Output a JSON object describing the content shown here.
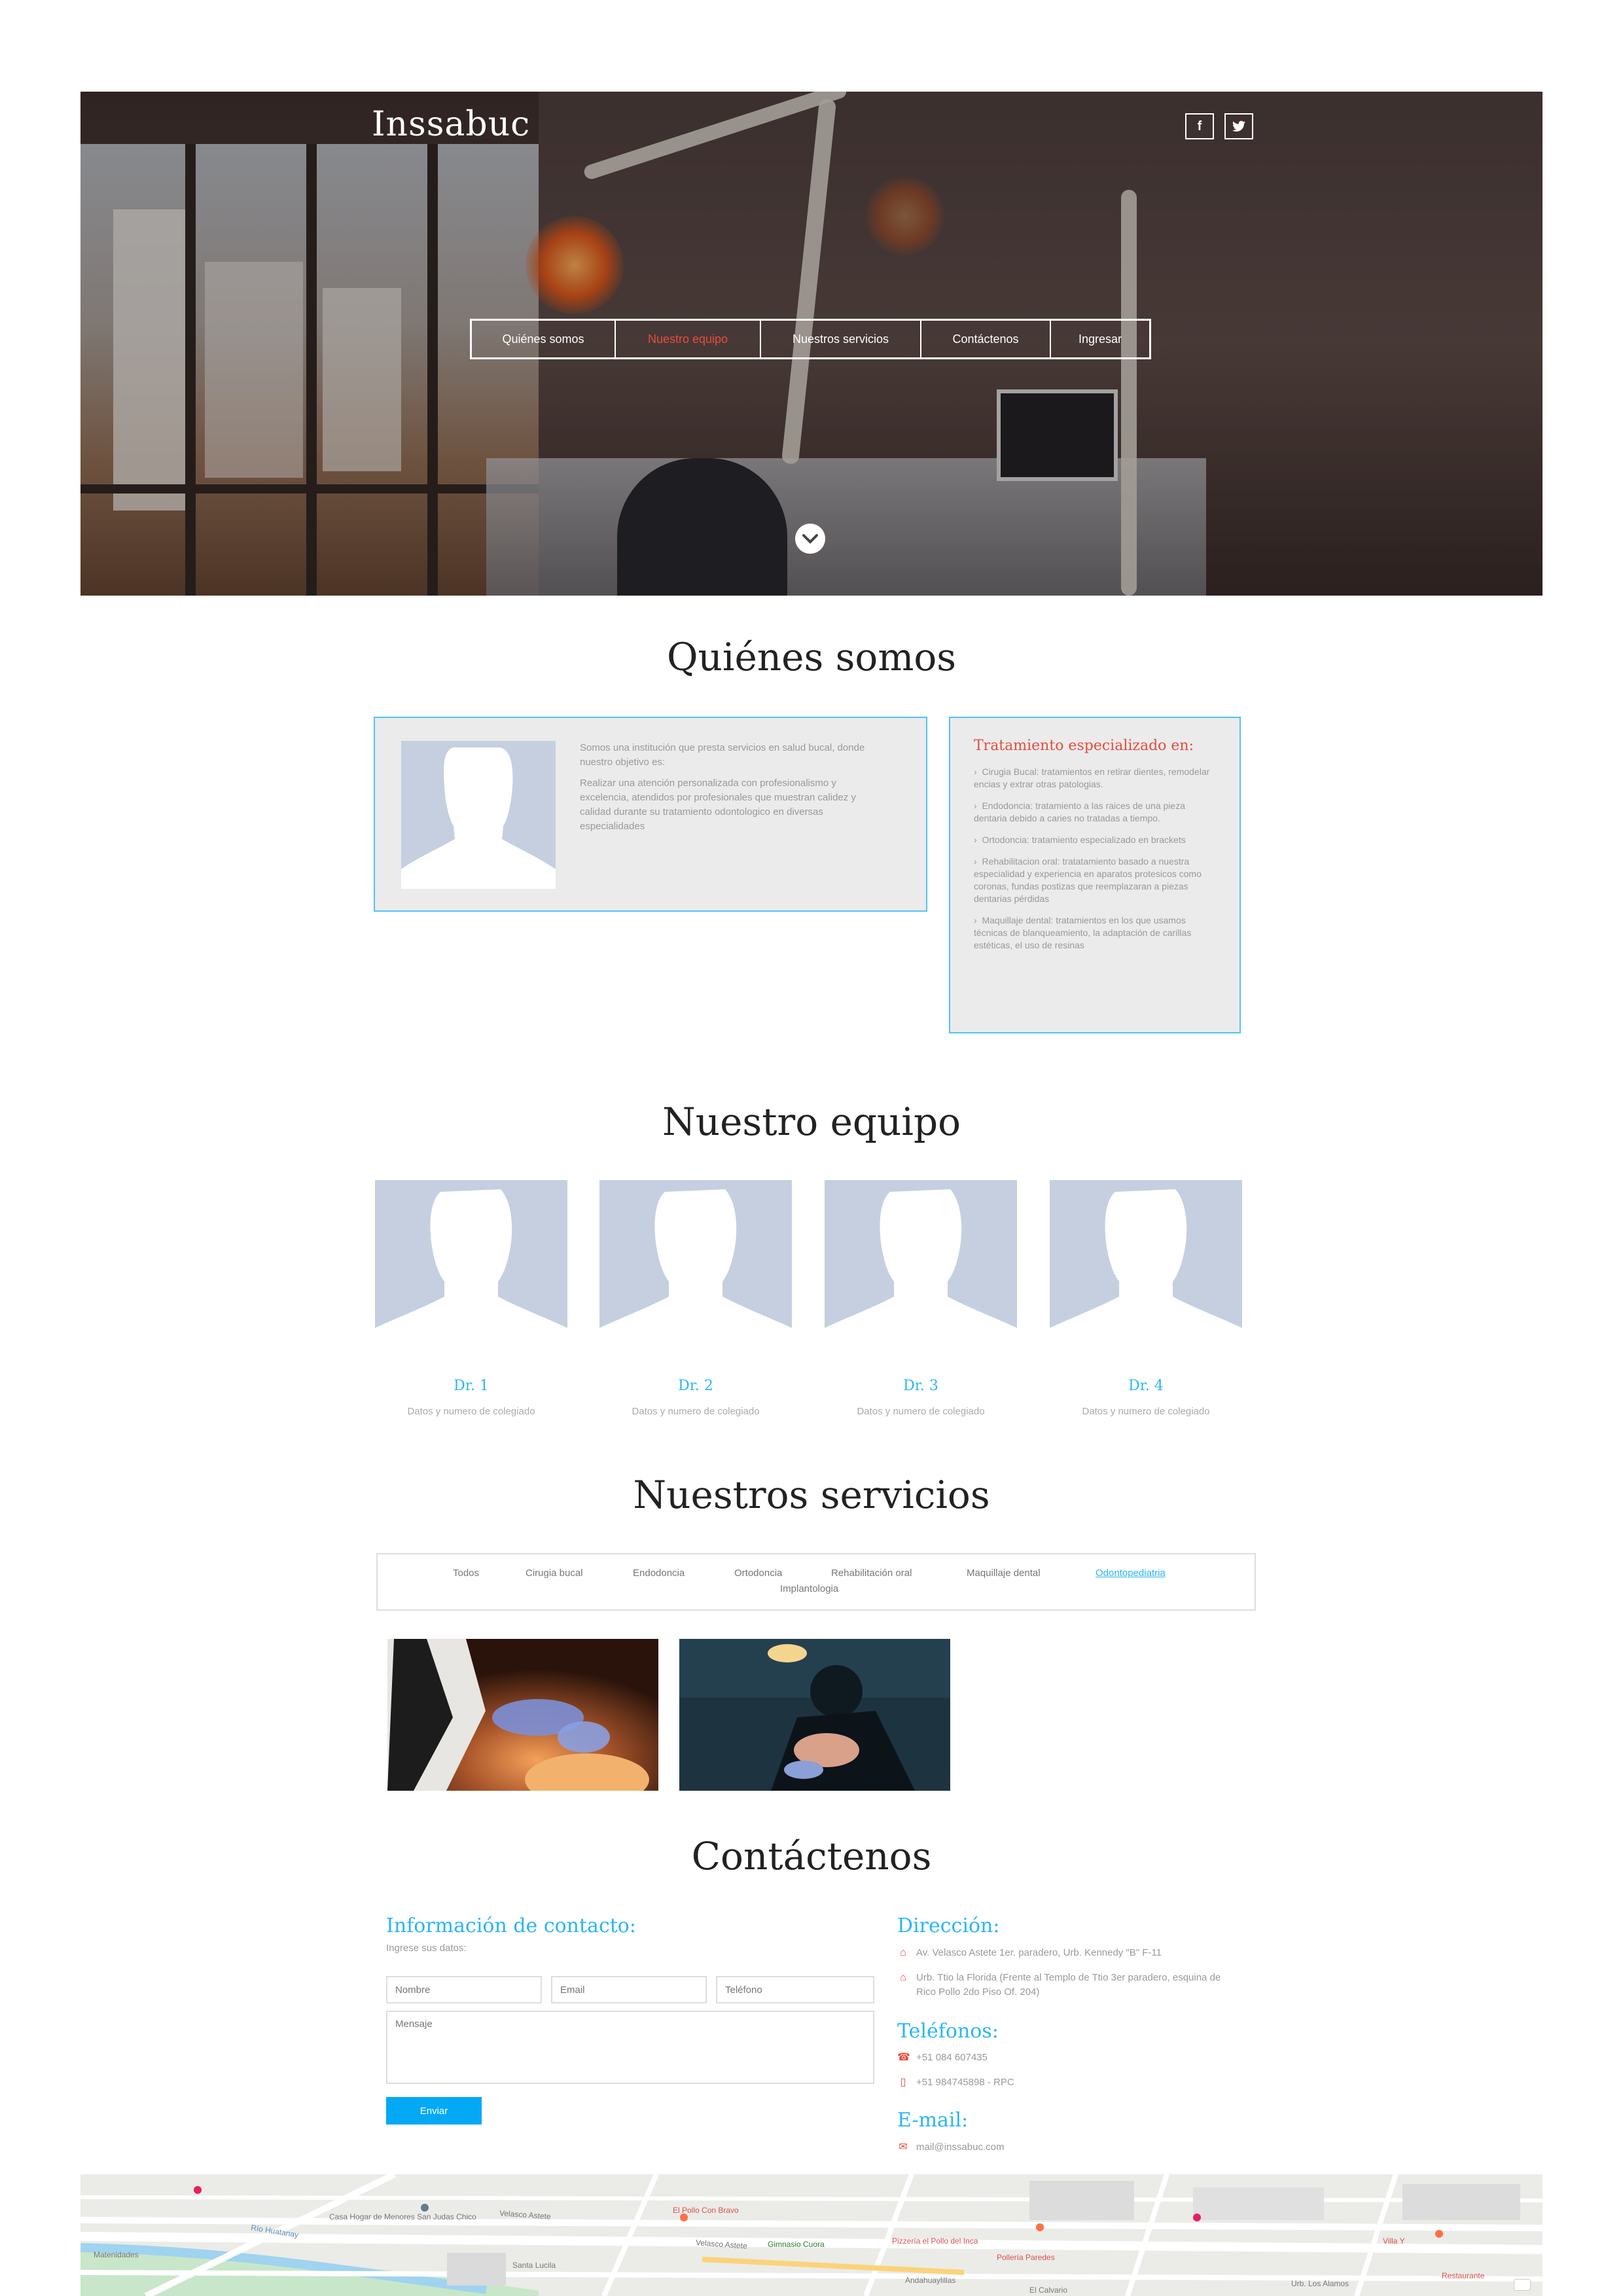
{
  "header": {
    "brand": "Inssabuc",
    "social": [
      {
        "label": "f",
        "icon": "facebook-icon"
      },
      {
        "label": "t",
        "icon": "twitter-icon"
      }
    ],
    "nav": [
      "Quiénes somos",
      "Nuestro equipo",
      "Nuestros servicios",
      "Contáctenos",
      "Ingresar"
    ],
    "active_nav": "Nuestro equipo"
  },
  "about": {
    "title": "Quiénes somos",
    "paragraph1": "Somos una institución que presta servicios en salud bucal, donde nuestro objetivo es:",
    "paragraph2": "Realizar una atención personalizada con profesionalismo y excelencia, atendidos por profesionales que muestran calidez y calidad durante su tratamiento odontologico en diversas especialidades",
    "treatment_title": "Tratamiento especializado en:",
    "treatments": [
      "Cirugia Bucal: tratamientos en retirar dientes, remodelar encias y extrar otras patologias.",
      "Endodoncia: tratamiento a las raices de una pieza dentaria debido a caries no tratadas a tiempo.",
      "Ortodoncia: tratamiento especializado en brackets",
      "Rehabilitacion oral: tratatamiento basado a nuestra especialidad y experiencia en aparatos protesicos como coronas, fundas postizas que reemplazaran a piezas dentarias pérdidas",
      "Maquillaje dental: tratamientos en los que usamos técnicas de blanqueamiento, la adaptación de carillas estéticas, el uso de resinas"
    ]
  },
  "team": {
    "title": "Nuestro equipo",
    "members": [
      {
        "name": "Dr. 1",
        "info": "Datos y numero de colegiado"
      },
      {
        "name": "Dr. 2",
        "info": "Datos y numero de colegiado"
      },
      {
        "name": "Dr. 3",
        "info": "Datos y numero de colegiado"
      },
      {
        "name": "Dr. 4",
        "info": "Datos y numero de colegiado"
      }
    ]
  },
  "services": {
    "title": "Nuestros servicios",
    "filters": [
      "Todos",
      "Cirugia bucal",
      "Endodoncia",
      "Ortodoncia",
      "Rehabilitación oral",
      "Maquillaje dental",
      "Odontopediatria",
      "Implantologia"
    ],
    "active_filter": "Odontopediatria"
  },
  "contact": {
    "title": "Contáctenos",
    "info_title": "Información de contacto:",
    "info_subtitle": "Ingrese sus datos:",
    "placeholders": {
      "name": "Nombre",
      "email": "Email",
      "phone": "Teléfono",
      "message": "Mensaje"
    },
    "send": "Enviar",
    "address_title": "Dirección:",
    "addresses": [
      "Av. Velasco Astete 1er. paradero, Urb. Kennedy \"B\" F-11",
      "Urb. Ttio la Florida (Frente al Templo de Ttio 3er paradero, esquina de Rico Pollo 2do Piso Of. 204)"
    ],
    "phones_title": "Teléfonos:",
    "phones": [
      "+51 084 607435",
      "+51 984745898 - RPC"
    ],
    "email_title": "E-mail:",
    "email": "mail@inssabuc.com"
  },
  "map": {
    "labels": [
      "Velasco Astete",
      "Velasco Astete",
      "Río Huatanay",
      "Santa Lucila",
      "El Pollo Con Bravo",
      "Gimnasio Cuora",
      "Pizzería el Pollo del Inca",
      "Pollería Paredes",
      "Casa Hogar de Menores San Judas Chico",
      "Matenidades",
      "Urb. Los Alamos",
      "Villa Y",
      "Restaurante",
      "El Calvario",
      "Andahuaylillas"
    ]
  },
  "colors": {
    "accent": "#29b6f6",
    "button": "#03a9f4",
    "nav_active": "#e74c3c",
    "card_border": "#4fc3f7",
    "card_bg": "#ebebeb"
  }
}
